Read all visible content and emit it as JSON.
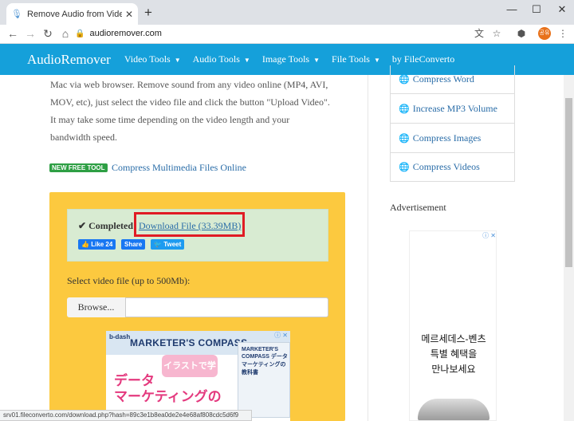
{
  "browser": {
    "tab_title": "Remove Audio from Video Onli",
    "tab_close": "✕",
    "new_tab": "+",
    "url": "audioremover.com",
    "avatar_text": "공유",
    "window_controls": {
      "minimize": "—",
      "maximize": "☐",
      "close": "✕"
    },
    "status_url": "srv01.fileconverto.com/download.php?hash=89c3e1b8ea0de2e4e68af808cdc5d6f9"
  },
  "site_nav": {
    "brand": "AudioRemover",
    "items": [
      {
        "label": "Video Tools",
        "has_dropdown": true
      },
      {
        "label": "Audio Tools",
        "has_dropdown": true
      },
      {
        "label": "Image Tools",
        "has_dropdown": true
      },
      {
        "label": "File Tools",
        "has_dropdown": true
      },
      {
        "label": "by FileConverto",
        "has_dropdown": false
      }
    ]
  },
  "main": {
    "intro_lines": [
      "Mac via web browser. Remove sound from any video online (MP4, AVI,",
      "MOV, etc), just select the video file and click the button \"Upload Video\".",
      "It may take some time depending on the video length and your",
      "bandwidth speed."
    ],
    "new_tool_badge": "NEW FREE TOOL",
    "new_tool_link": "Compress Multimedia Files Online",
    "completed_label": "Completed",
    "download_link": "Download File (33.39MB)",
    "social": {
      "like": "Like 24",
      "share": "Share",
      "tweet": "Tweet"
    },
    "select_label": "Select video file (up to 500Mb):",
    "browse_label": "Browse...",
    "ad": {
      "brand": "MARKETER'S COMPASS",
      "logo": "b-dash",
      "pink_badge": "イラストで学ぶ!",
      "headline1": "データ",
      "headline2": "マーケティングの",
      "book_text": "MARKETER'S COMPASS データマーケティングの教科書"
    }
  },
  "sidebar": {
    "links": [
      "Compress Word",
      "Increase MP3 Volume",
      "Compress Images",
      "Compress Videos"
    ],
    "ad_label": "Advertisement",
    "ad_lines": [
      "메르세데스-벤츠",
      "특별 혜택을",
      "만나보세요"
    ]
  },
  "colors": {
    "nav_bg": "#15a0da",
    "upload_bg": "#fcc93f",
    "success_bg": "#d8ebd2",
    "highlight": "#e01b24",
    "link": "#2a6da8"
  }
}
